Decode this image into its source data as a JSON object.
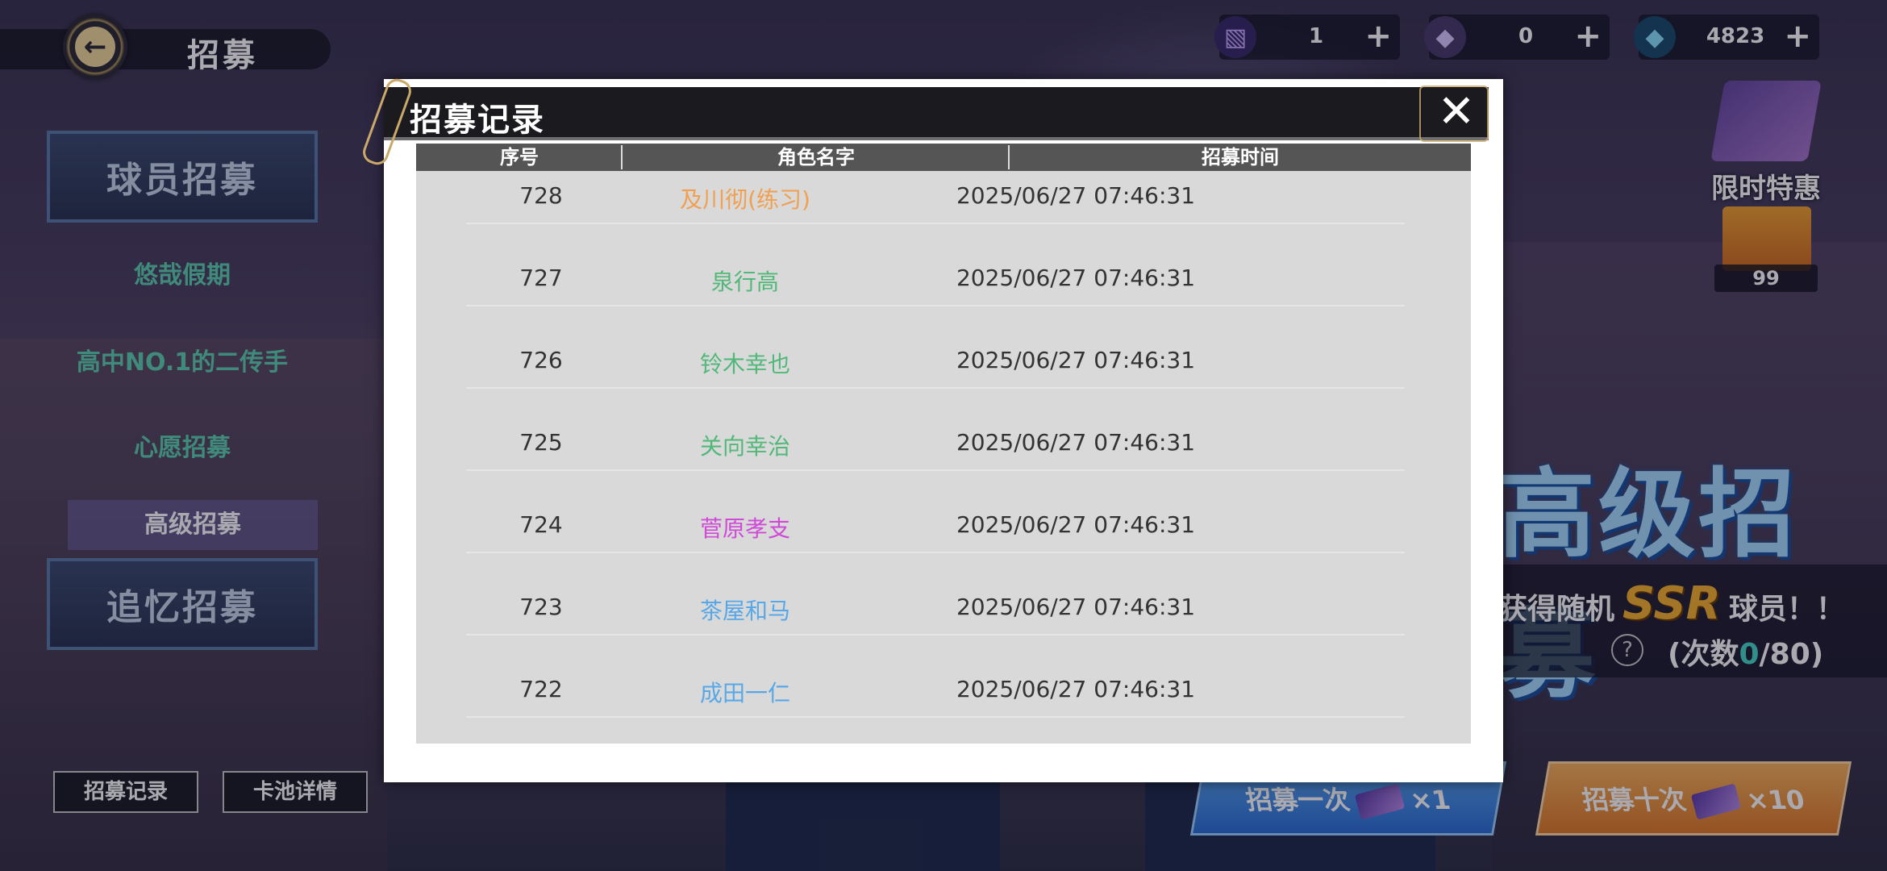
{
  "header": {
    "title": "招募"
  },
  "currencies": [
    {
      "icon": "ticket-icon",
      "value": "1"
    },
    {
      "icon": "crystal-icon",
      "value": "0"
    },
    {
      "icon": "diamond-icon",
      "value": "4823"
    }
  ],
  "left_menu": {
    "player_recruit": "球员招募",
    "items": [
      "悠哉假期",
      "高中NO.1的二传手",
      "心愿招募",
      "高级招募"
    ],
    "memory_recruit": "追忆招募",
    "record_button": "招募记录",
    "pool_button": "卡池详情"
  },
  "right_panel": {
    "promo_label": "限时特惠",
    "shop_count": "99",
    "banner_title": "高级招募",
    "banner_desc_prefix": "获得随机",
    "banner_ssr": "SSR",
    "banner_desc_suffix": "球员！！",
    "count_prefix": "(次数",
    "count_current": "0",
    "count_suffix": "/80)",
    "recruit_once": "招募一次",
    "recruit_once_qty": "×1",
    "recruit_ten": "招募十次",
    "recruit_ten_qty": "×10"
  },
  "modal": {
    "title": "招募记录",
    "columns": [
      "序号",
      "角色名字",
      "招募时间"
    ],
    "rows": [
      {
        "no": "728",
        "name": "及川彻(练习)",
        "color": "#f0a050",
        "time": "2025/06/27 07:46:31"
      },
      {
        "no": "727",
        "name": "泉行高",
        "color": "#52b87a",
        "time": "2025/06/27 07:46:31"
      },
      {
        "no": "726",
        "name": "铃木幸也",
        "color": "#52b87a",
        "time": "2025/06/27 07:46:31"
      },
      {
        "no": "725",
        "name": "关向幸治",
        "color": "#52b87a",
        "time": "2025/06/27 07:46:31"
      },
      {
        "no": "724",
        "name": "菅原孝支",
        "color": "#d04ad8",
        "time": "2025/06/27 07:46:31"
      },
      {
        "no": "723",
        "name": "茶屋和马",
        "color": "#58a8e8",
        "time": "2025/06/27 07:46:31"
      },
      {
        "no": "722",
        "name": "成田一仁",
        "color": "#58a8e8",
        "time": "2025/06/27 07:46:31"
      }
    ]
  }
}
